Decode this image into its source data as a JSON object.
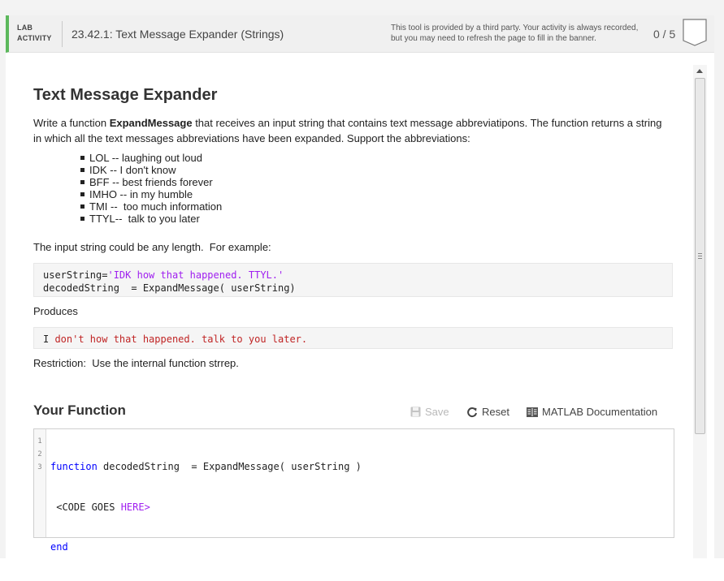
{
  "banner": {
    "tag_line1": "LAB",
    "tag_line2": "ACTIVITY",
    "title": "23.42.1: Text Message Expander (Strings)",
    "note_line1": "This tool is provided by a third party. Your activity is always recorded,",
    "note_line2": "but you may need to refresh the page to fill in the banner.",
    "score": "0 / 5"
  },
  "content": {
    "title": "Text Message Expander",
    "desc_part1": "Write a function ",
    "desc_bold": "ExpandMessage",
    "desc_part2": " that receives an input string that contains text message abbreviatipons.  The function returns a string in which all the text messages abbreviations have been expanded.   Support the abbreviations:",
    "abbreviations": [
      "LOL -- laughing out loud",
      "IDK -- I don't know",
      "BFF -- best friends forever",
      "IMHO -- in my humble",
      "TMI --  too much information",
      "TTYL--  talk to you later"
    ],
    "input_note": "The input string could be any length.  For example:",
    "example_line1_prefix": "userString=",
    "example_line1_string": "'IDK how that happened. TTYL.'",
    "example_line2": "decodedString  = ExpandMessage( userString)",
    "produces_label": "Produces",
    "output_prefix": "I ",
    "output_rest": "don't how that happened. talk to you later.",
    "restriction": "Restriction:  Use the internal function strrep."
  },
  "function_section": {
    "heading": "Your Function",
    "save_label": "Save",
    "reset_label": "Reset",
    "doc_label": "MATLAB Documentation"
  },
  "editor": {
    "line_numbers": [
      "1",
      "2",
      "3"
    ],
    "line1_keyword": "function",
    "line1_rest": " decodedString  = ExpandMessage( userString )",
    "line2_plain": " <CODE GOES ",
    "line2_colored": "HERE>",
    "line3_keyword": "end"
  },
  "colors": {
    "accent_green": "#5cb85c",
    "keyword_blue": "#0000ff",
    "string_purple": "#a020f0",
    "output_red": "#c02525"
  },
  "icons": {
    "save": "floppy-disk-icon",
    "reset": "refresh-icon",
    "doc": "book-icon",
    "score": "score-badge-icon"
  }
}
